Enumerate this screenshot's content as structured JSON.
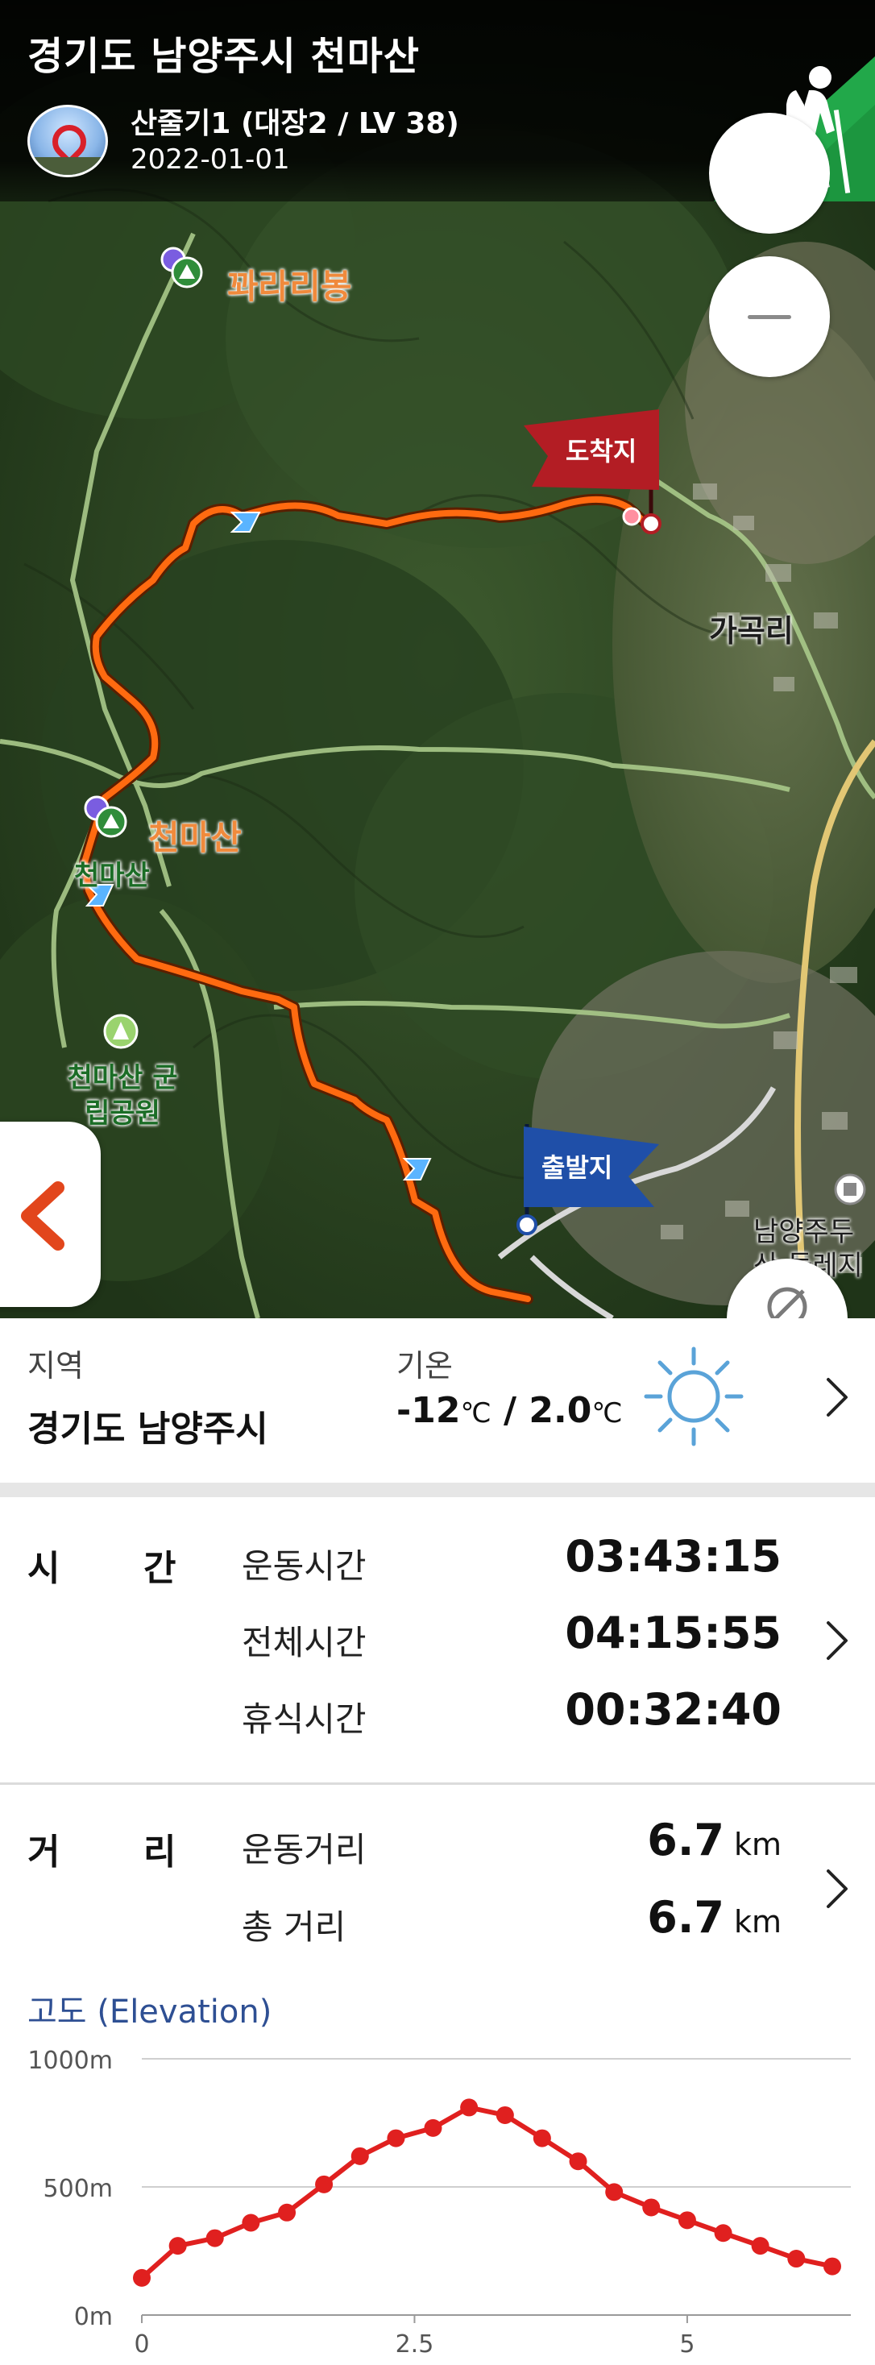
{
  "header": {
    "title": "경기도 남양주시 천마산",
    "user": "산줄기1 (대장2 / LV 38)",
    "date": "2022-01-01"
  },
  "map": {
    "labels": {
      "peak_north": "꽈라리봉",
      "arrival": "도착지",
      "village": "가곡리",
      "peak_main": "천마산",
      "peak_small": "천마산",
      "park": "천마산 군립공원",
      "departure": "출발지",
      "bottom_right": "남양주두산 둘레지"
    },
    "route_color": "#ff6a10",
    "arrival_flag_color": "#b31d24",
    "departure_flag_color": "#1f4fa8"
  },
  "region": {
    "region_label": "지역",
    "region_value": "경기도 남양주시",
    "temp_label": "기온",
    "temp_low": "-12",
    "temp_high": "2.0",
    "temp_unit": "℃",
    "temp_sep": "/",
    "weather_icon": "sun-icon"
  },
  "time": {
    "heading_1": "시",
    "heading_2": "간",
    "rows": [
      {
        "label": "운동시간",
        "value": "03:43:15"
      },
      {
        "label": "전체시간",
        "value": "04:15:55"
      },
      {
        "label": "휴식시간",
        "value": "00:32:40"
      }
    ]
  },
  "distance": {
    "heading_1": "거",
    "heading_2": "리",
    "unit": "km",
    "rows": [
      {
        "label": "운동거리",
        "value": "6.7"
      },
      {
        "label": "총 거리",
        "value": "6.7"
      }
    ]
  },
  "elevation": {
    "title": "고도 (Elevation)"
  },
  "chart_data": {
    "type": "line",
    "title": "고도 (Elevation)",
    "xlabel": "",
    "ylabel": "",
    "xlim": [
      0,
      6.5
    ],
    "ylim": [
      0,
      1000
    ],
    "x_ticks": [
      "0",
      "2.5",
      "5"
    ],
    "y_ticks": [
      "1000m",
      "500m",
      "0m"
    ],
    "grid": true,
    "color": "#e0201f",
    "series": [
      {
        "x": [
          0,
          0.33,
          0.67,
          1.0,
          1.33,
          1.67,
          2.0,
          2.33,
          2.67,
          3.0,
          3.33,
          3.67,
          4.0,
          4.33,
          4.67,
          5.0,
          5.33,
          5.67,
          6.0,
          6.33
        ],
        "y": [
          145,
          270,
          300,
          360,
          400,
          510,
          620,
          690,
          730,
          810,
          780,
          690,
          600,
          480,
          420,
          370,
          320,
          270,
          220,
          190
        ]
      }
    ]
  }
}
